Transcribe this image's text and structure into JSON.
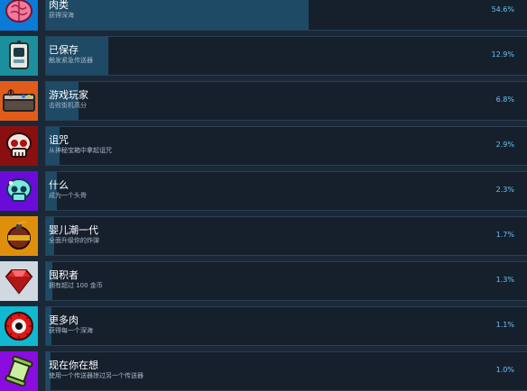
{
  "achievements": [
    {
      "id": "meat",
      "name": "肉类",
      "desc": "获得深海",
      "percent": "54.6%",
      "fill": 0.546,
      "icon": "brain-icon",
      "bg": "#0a7bd6"
    },
    {
      "id": "saved",
      "name": "已保存",
      "desc": "触发紧急传送器",
      "percent": "12.9%",
      "fill": 0.129,
      "icon": "device-icon",
      "bg": "#1b8f9b"
    },
    {
      "id": "gamer",
      "name": "游戏玩家",
      "desc": "击败街机高分",
      "percent": "6.8%",
      "fill": 0.068,
      "icon": "arcade-cabinet-icon",
      "bg": "#e05c1a"
    },
    {
      "id": "curse",
      "name": "诅咒",
      "desc": "从神秘宝箱中拿起诅咒",
      "percent": "2.9%",
      "fill": 0.029,
      "icon": "skull-icon",
      "bg": "#8a1010"
    },
    {
      "id": "what",
      "name": "什么",
      "desc": "成为一个头骨",
      "percent": "2.3%",
      "fill": 0.023,
      "icon": "ghost-skull-icon",
      "bg": "#6a0cd9"
    },
    {
      "id": "boomer",
      "name": "婴儿潮一代",
      "desc": "全面升级你的炸弹",
      "percent": "1.7%",
      "fill": 0.017,
      "icon": "bomb-icon",
      "bg": "#e08f0c"
    },
    {
      "id": "hoarder",
      "name": "囤积者",
      "desc": "拥有超过 100 金币",
      "percent": "1.3%",
      "fill": 0.013,
      "icon": "gem-icon",
      "bg": "#d0d8e0"
    },
    {
      "id": "more_meat",
      "name": "更多肉",
      "desc": "获得每一个深海",
      "percent": "1.1%",
      "fill": 0.011,
      "icon": "eyeball-icon",
      "bg": "#10b8d0"
    },
    {
      "id": "thinking",
      "name": "现在你在想",
      "desc": "使用一个传送器掠过另一个传送器",
      "percent": "1.0%",
      "fill": 0.01,
      "icon": "scroll-icon",
      "bg": "#8a0ce0"
    }
  ]
}
